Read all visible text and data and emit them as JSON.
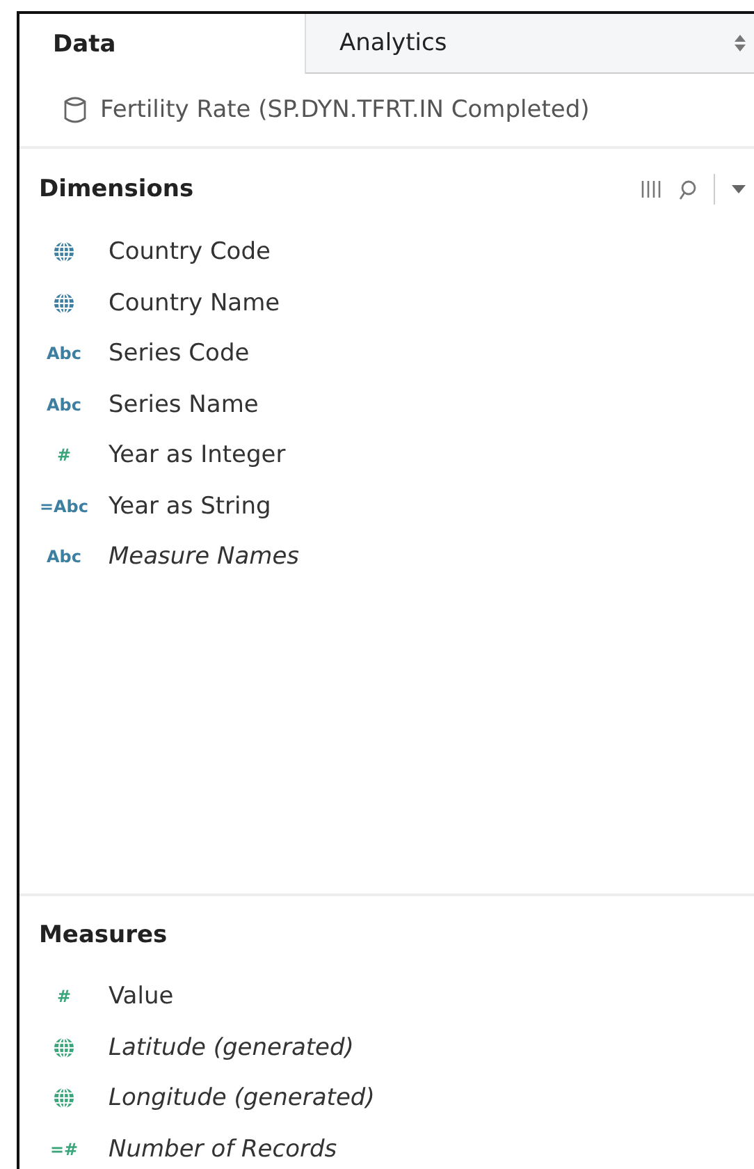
{
  "tabs": [
    {
      "label": "Data",
      "selected": true
    },
    {
      "label": "Analytics",
      "selected": false
    }
  ],
  "datasource": "Fertility Rate (SP.DYN.TFRT.IN Completed)",
  "dimensions": {
    "title": "Dimensions",
    "items": [
      {
        "kind": "globe",
        "name": "Country Code",
        "italic": false
      },
      {
        "kind": "globe",
        "name": "Country Name",
        "italic": false
      },
      {
        "kind": "text",
        "icon_text": "Abc",
        "name": "Series Code",
        "italic": false
      },
      {
        "kind": "text",
        "icon_text": "Abc",
        "name": "Series Name",
        "italic": false
      },
      {
        "kind": "text",
        "icon_text": "#",
        "name": "Year as Integer",
        "italic": false
      },
      {
        "kind": "text",
        "icon_text": "=Abc",
        "name": "Year as String",
        "italic": false
      },
      {
        "kind": "text",
        "icon_text": "Abc",
        "name": "Measure Names",
        "italic": true
      }
    ]
  },
  "measures": {
    "title": "Measures",
    "items": [
      {
        "kind": "text",
        "icon_text": "#",
        "name": "Value",
        "italic": false
      },
      {
        "kind": "globe",
        "name": "Latitude (generated)",
        "italic": true
      },
      {
        "kind": "globe",
        "name": "Longitude (generated)",
        "italic": true
      },
      {
        "kind": "text",
        "icon_text": "=#",
        "name": "Number of Records",
        "italic": true
      }
    ]
  }
}
